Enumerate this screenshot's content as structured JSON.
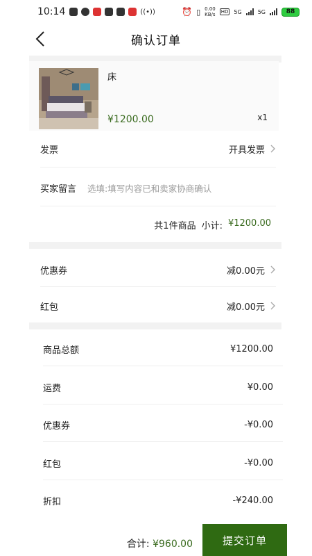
{
  "status": {
    "time": "10:14",
    "speed": "0.00\nKB/s",
    "net1": "5G",
    "net2": "5G",
    "battery": "88"
  },
  "nav": {
    "title": "确认订单"
  },
  "product": {
    "name": "床",
    "price": "¥1200.00",
    "qty": "x1"
  },
  "invoice": {
    "label": "发票",
    "value": "开具发票"
  },
  "remark": {
    "label": "买家留言",
    "placeholder": "选填:填写内容已和卖家协商确认"
  },
  "summary": {
    "count_text": "共1件商品",
    "subtotal_label": "小计:",
    "subtotal": "¥1200.00"
  },
  "discounts": {
    "coupon_label": "优惠券",
    "coupon_value": "减0.00元",
    "redpacket_label": "红包",
    "redpacket_value": "减0.00元"
  },
  "breakdown": [
    {
      "label": "商品总额",
      "value": "¥1200.00"
    },
    {
      "label": "运费",
      "value": "¥0.00"
    },
    {
      "label": "优惠券",
      "value": "-¥0.00"
    },
    {
      "label": "红包",
      "value": "-¥0.00"
    },
    {
      "label": "折扣",
      "value": "-¥240.00"
    }
  ],
  "footer": {
    "total_label": "合计:",
    "total": "¥960.00",
    "submit": "提交订单"
  },
  "colors": {
    "accent": "#2f6a12",
    "price": "#3a6b1f"
  }
}
